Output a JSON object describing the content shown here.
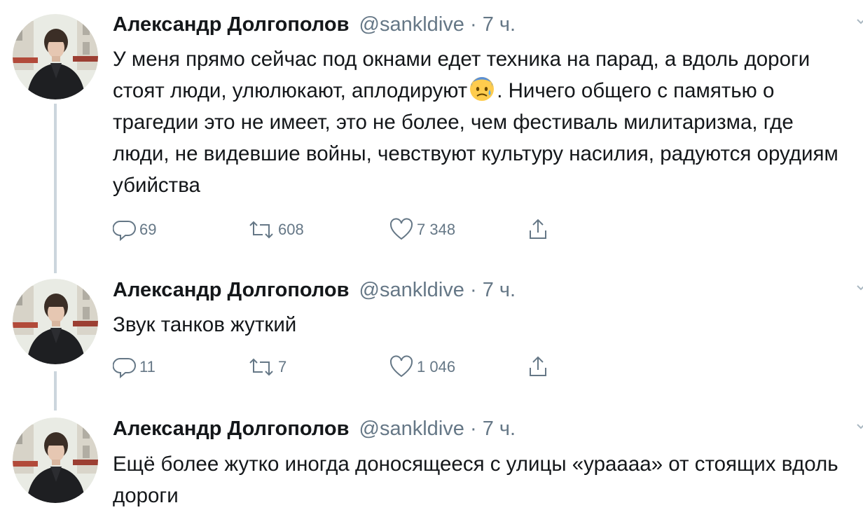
{
  "tweets": [
    {
      "name": "Александр Долгополов",
      "handle": "@sankldive",
      "separator": "·",
      "time": "7 ч.",
      "text_before_emoji": "У меня прямо сейчас под окнами едет техника на парад, а вдоль дороги стоят люди, улюлюкают, аплодируют",
      "emoji": "anxious-face-with-sweat",
      "text_after_emoji": ". Ничего общего с памятью о трагедии это не имеет, это не более, чем фестиваль милитаризма, где люди, не видевшие войны, чевствуют культуру насилия, радуются орудиям убийства",
      "replies": "69",
      "retweets": "608",
      "likes": "7 348"
    },
    {
      "name": "Александр Долгополов",
      "handle": "@sankldive",
      "separator": "·",
      "time": "7 ч.",
      "text": "Звук танков жуткий",
      "replies": "11",
      "retweets": "7",
      "likes": "1 046"
    },
    {
      "name": "Александр Долгополов",
      "handle": "@sankldive",
      "separator": "·",
      "time": "7 ч.",
      "text": "Ещё более жутко иногда доносящееся с улицы «ураааа» от стоящих вдоль дороги"
    }
  ],
  "icons": {
    "reply": "reply-icon",
    "retweet": "retweet-icon",
    "like": "heart-icon",
    "share": "share-icon",
    "menu": "chevron-down-icon"
  },
  "colors": {
    "text": "#14171a",
    "secondary": "#657786",
    "thread_line": "#ccd6dd"
  }
}
